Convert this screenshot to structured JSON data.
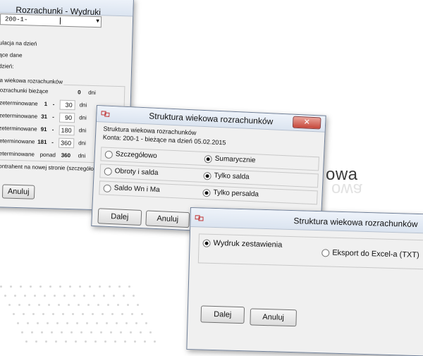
{
  "background_text": "owa",
  "win1": {
    "title": "Rozrachunki - Wydruki",
    "account_value": "200-1-",
    "labels": [
      "ulacja na dzień",
      "ące dane",
      "dzień:"
    ],
    "group_title": "a wiekowa rozrachunków",
    "rows": [
      {
        "label": "rozrachunki bieżące",
        "op": "",
        "from": "",
        "to": "0",
        "unit": "dni"
      },
      {
        "label": "rzeterminowane",
        "op": "1",
        "from": "",
        "to": "30",
        "unit": "dni"
      },
      {
        "label": "rzeterminowane",
        "op": "31",
        "from": "",
        "to": "90",
        "unit": "dni"
      },
      {
        "label": "rzeterminowane",
        "op": "91",
        "from": "",
        "to": "180",
        "unit": "dni"
      },
      {
        "label": "zeterminowane",
        "op": "181",
        "from": "",
        "to": "360",
        "unit": "dni"
      },
      {
        "label": "zeterminowane",
        "op": "ponad",
        "from": "",
        "to": "360",
        "unit": "dni"
      }
    ],
    "dash": "-",
    "footer_text": "kontrahent na nowej stronie (szczegółow",
    "cancel_label": "Anuluj"
  },
  "win2": {
    "title": "Struktura wiekowa rozrachunków",
    "line1": "Struktura wiekowa rozrachunków",
    "line2": "Konta: 200-1 - bieżące na dzień 05.02.2015",
    "options_left": [
      "Szczegółowo",
      "Obroty i salda",
      "Saldo Wn i Ma"
    ],
    "options_right": [
      "Sumarycznie",
      "Tylko salda",
      "Tylko persalda"
    ],
    "next_label": "Dalej",
    "cancel_label": "Anuluj"
  },
  "win3": {
    "title": "Struktura wiekowa rozrachunków",
    "option1": "Wydruk zestawienia",
    "option2": "Eksport do Excel-a (TXT)",
    "next_label": "Dalej",
    "cancel_label": "Anuluj"
  }
}
